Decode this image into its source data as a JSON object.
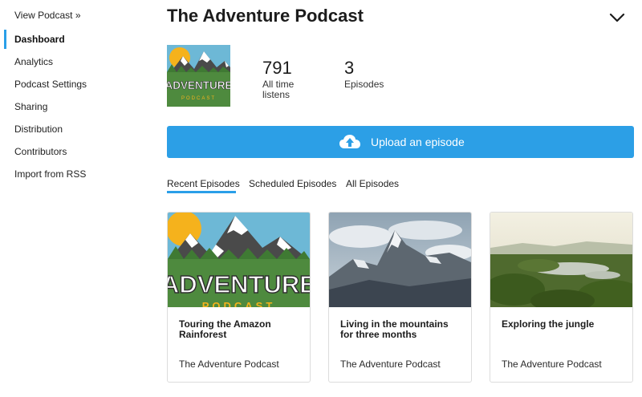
{
  "sidebar": {
    "view_podcast": "View Podcast »",
    "items": [
      "Dashboard",
      "Analytics",
      "Podcast Settings",
      "Sharing",
      "Distribution",
      "Contributors",
      "Import from RSS"
    ]
  },
  "header": {
    "title": "The Adventure Podcast"
  },
  "cover_art": {
    "line1": "ADVENTURE",
    "line2": "PODCAST"
  },
  "stats": [
    {
      "value": "791",
      "label_line1": "All time",
      "label_line2": "listens"
    },
    {
      "value": "3",
      "label_line1": "Episodes"
    }
  ],
  "upload": {
    "label": "Upload an episode"
  },
  "tabs": [
    "Recent Episodes",
    "Scheduled Episodes",
    "All Episodes"
  ],
  "active_tab": "Recent Episodes",
  "episodes": [
    {
      "title": "Touring the Amazon Rainforest",
      "podcast": "The Adventure Podcast"
    },
    {
      "title": "Living in the mountains for three months",
      "podcast": "The Adventure Podcast"
    },
    {
      "title": "Exploring the jungle",
      "podcast": "The Adventure Podcast"
    }
  ],
  "colors": {
    "accent": "#2c9fe6",
    "active_indicator": "#2a9fe8"
  }
}
